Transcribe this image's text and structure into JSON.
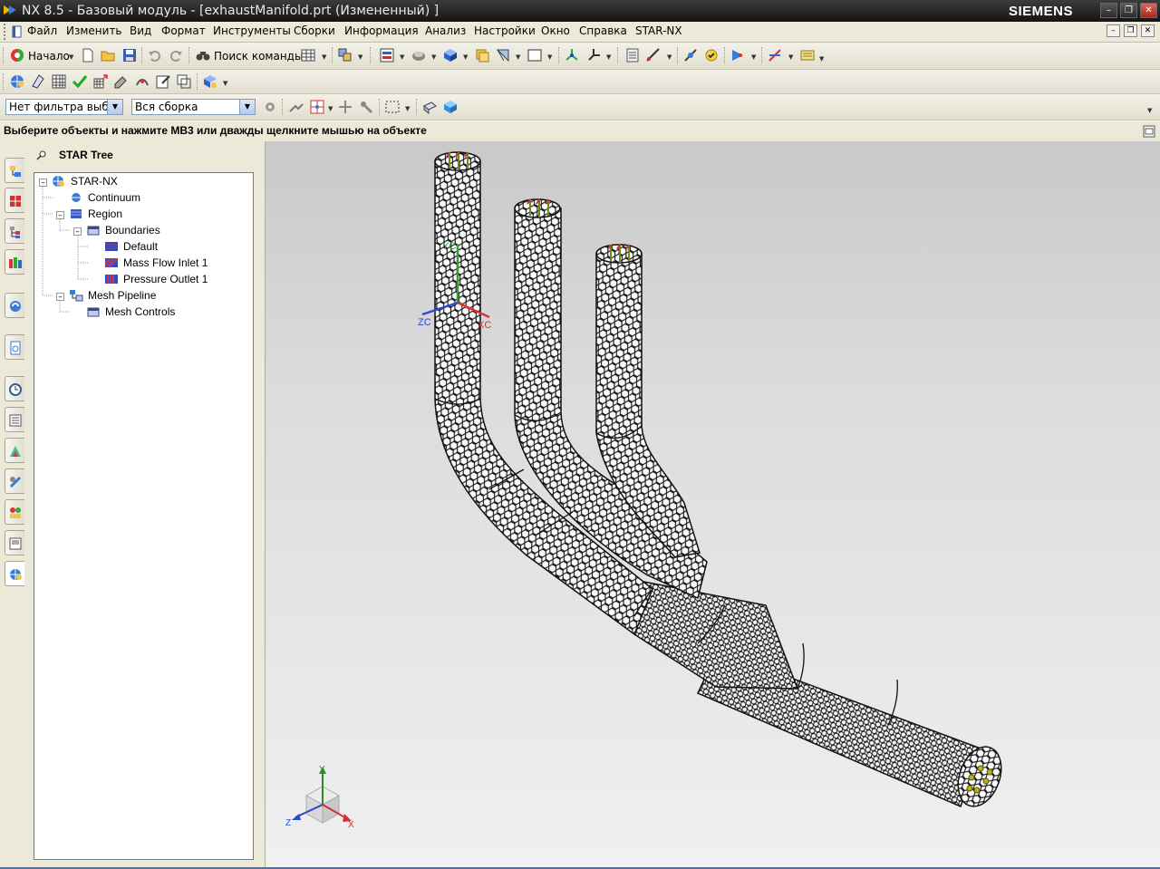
{
  "window": {
    "title": "NX 8.5 - Базовый модуль - [exhaustManifold.prt (Измененный) ]",
    "brand": "SIEMENS"
  },
  "menu": {
    "items": [
      "Файл",
      "Изменить",
      "Вид",
      "Формат",
      "Инструменты",
      "Сборки",
      "Информация",
      "Анализ",
      "Настройки",
      "Окно",
      "Справка",
      "STAR-NX"
    ]
  },
  "toolbar": {
    "start_label": "Начало",
    "command_finder_label": "Поиск команды"
  },
  "selection_bar": {
    "type_filter_value": "Нет фильтра выбо",
    "scope_value": "Вся сборка"
  },
  "cue_line": {
    "text": "Выберите объекты и нажмите MB3 или дважды щелкните мышью на объекте"
  },
  "navigator": {
    "title": "STAR Tree",
    "tree": {
      "root": "STAR-NX",
      "continuum": "Continuum",
      "region": "Region",
      "boundaries": "Boundaries",
      "default": "Default",
      "mass_flow_inlet": "Mass Flow Inlet 1",
      "pressure_outlet": "Pressure Outlet 1",
      "mesh_pipeline": "Mesh Pipeline",
      "mesh_controls": "Mesh Controls"
    }
  },
  "viewport": {
    "wcs_labels": {
      "x": "XC",
      "y": "YC",
      "z": "ZC"
    },
    "triad_labels": {
      "x": "X",
      "y": "Y",
      "z": "Z"
    }
  },
  "colors": {
    "title_bar": "#1f1f1f",
    "menu_background": "#ece9d8",
    "viewport_top": "#c9c9c9",
    "viewport_bottom": "#f0f0f0",
    "mesh_line": "#111111"
  }
}
